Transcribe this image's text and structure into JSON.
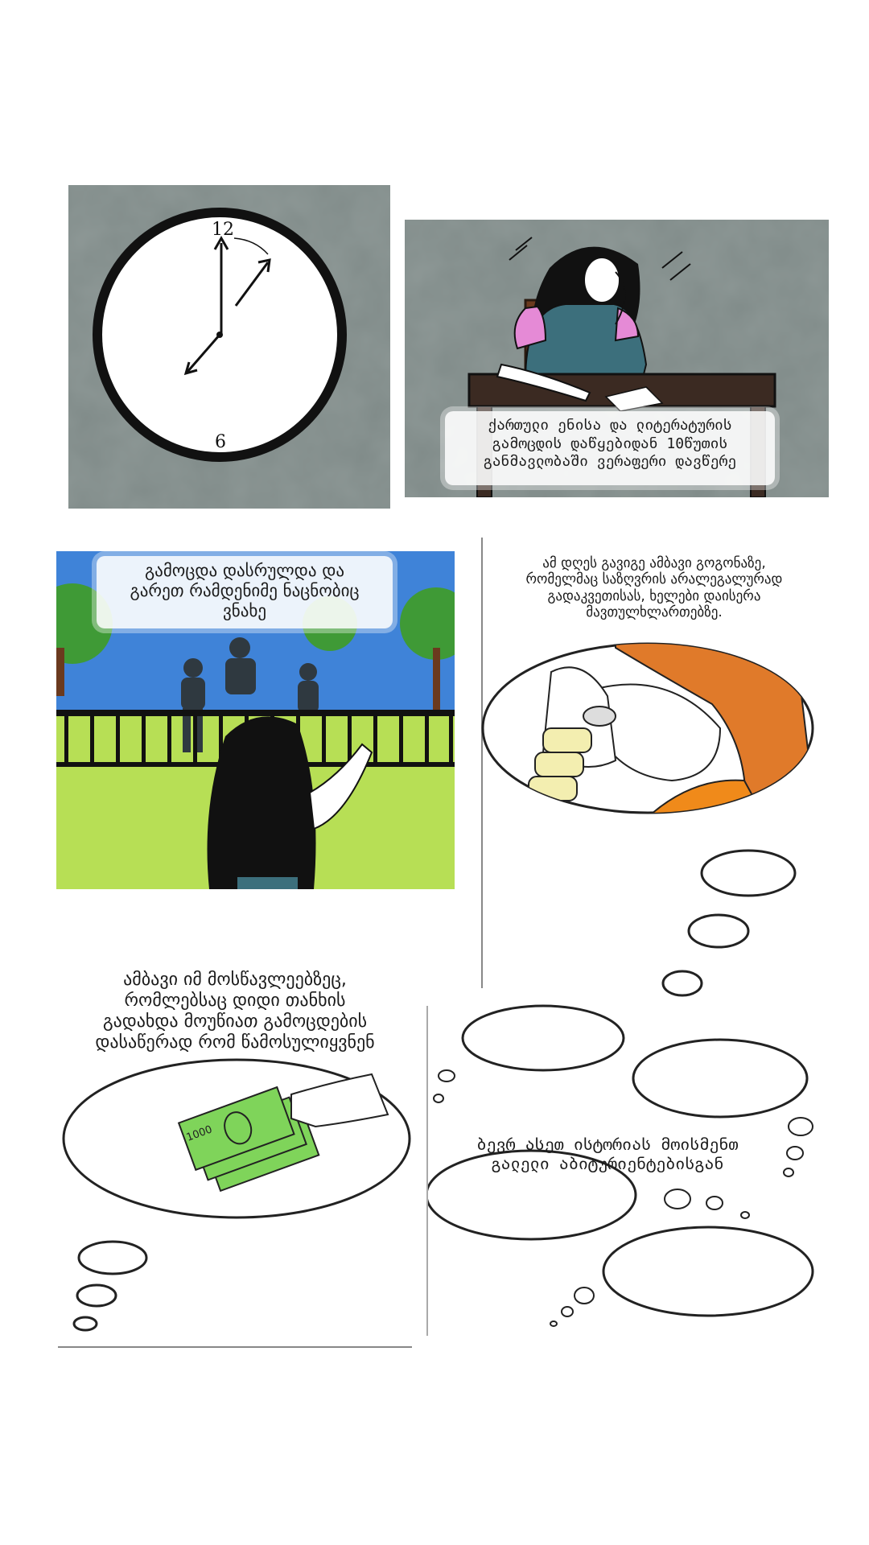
{
  "panels": {
    "exam_caption": {
      "line1": "ქართული ენისა და ლიტერატურის",
      "line2": "გამოცდის დაწყებიდან 10წუთის",
      "line3": "განმავლობაში ვერაფერი დავწერე"
    },
    "friends_caption": {
      "line1": "გამოცდა დასრულდა და",
      "line2": "გარეთ რამდენიმე ნაცნობიც",
      "line3": "ვნახე"
    },
    "news_caption": {
      "line1": "ამ დღეს გავიგე ამბავი გოგონაზე,",
      "line2": "რომელმაც საზღვრის არალეგალურად",
      "line3": "გადაკვეთისას, ხელები დაისერა",
      "line4": "მავთულხლართებზე."
    },
    "bribe_caption": {
      "line1": "ამბავი იმ მოსწავლეებზეც,",
      "line2": "რომლებსაც დიდი თანხის",
      "line3": "გადახდა მოუწიათ გამოცდების",
      "line4": "დასაწერად რომ წამოსულიყვნენ"
    },
    "stories_caption": {
      "line1": "ბევრ ასეთ ისტორიას მოისმენთ",
      "line2": "გალელი აბიტურიენტებისგან"
    }
  },
  "clock": {
    "top_number": "12",
    "bottom_number": "6"
  },
  "money": {
    "note_label": "1000"
  },
  "colors": {
    "wash_gray": "#7f8a88",
    "sky_blue": "#3f83d8",
    "grass_green": "#b7df55",
    "tree_green": "#3f9a36",
    "money_green": "#7fd45a",
    "hair_orange": "#e07a2a",
    "shirt_pink": "#e58ad6",
    "shirt_teal": "#3c6f7c"
  }
}
